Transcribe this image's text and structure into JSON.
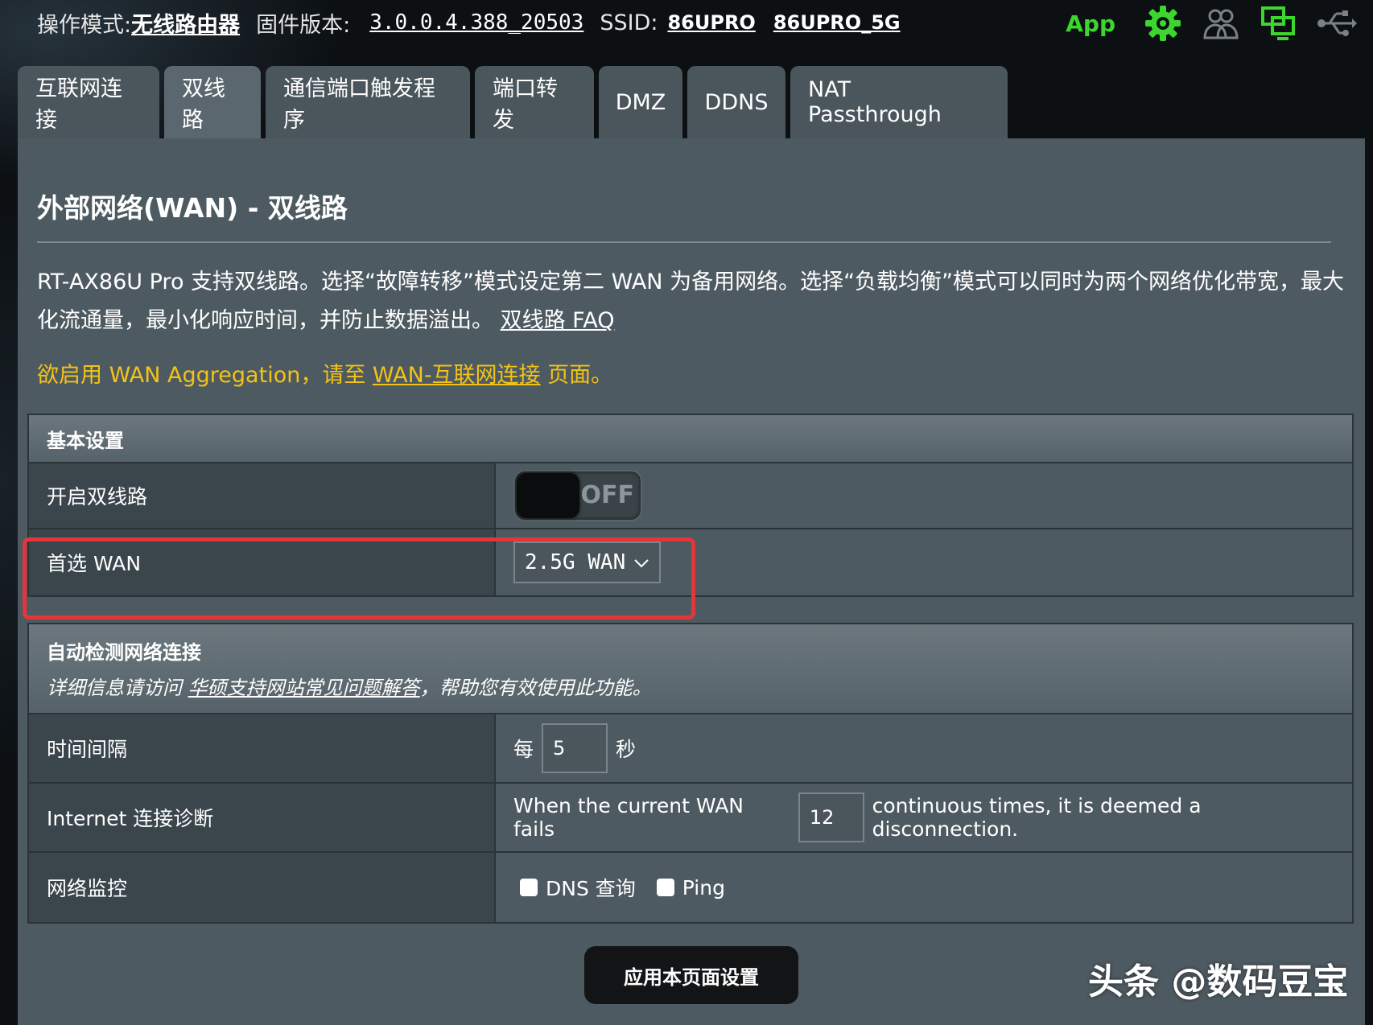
{
  "topbar": {
    "mode_label": "操作模式:",
    "mode_value": "无线路由器",
    "firmware_label": "固件版本:",
    "firmware_value": "3.0.0.4.388_20503",
    "ssid_label": "SSID:",
    "ssid_1": "86UPRO",
    "ssid_2": "86UPRO_5G",
    "app_label": "App",
    "icons": [
      "gear-icon",
      "users-icon",
      "network-icon",
      "usb-icon"
    ],
    "accent_color": "#3dd62e"
  },
  "tabs": [
    {
      "label": "互联网连接",
      "active": false
    },
    {
      "label": "双线路",
      "active": true
    },
    {
      "label": "通信端口触发程序",
      "active": false
    },
    {
      "label": "端口转发",
      "active": false
    },
    {
      "label": "DMZ",
      "active": false
    },
    {
      "label": "DDNS",
      "active": false
    },
    {
      "label": "NAT Passthrough",
      "active": false
    }
  ],
  "page": {
    "title": "外部网络(WAN) - 双线路",
    "description": "RT-AX86U Pro 支持双线路。选择“故障转移”模式设定第二 WAN 为备用网络。选择“负载均衡”模式可以同时为两个网络优化带宽，最大化流通量，最小化响应时间，并防止数据溢出。",
    "faq_link": "双线路 FAQ",
    "notice_prefix": "欲启用 WAN Aggregation，请至 ",
    "notice_link": "WAN-互联网连接",
    "notice_suffix": " 页面。",
    "notice_color": "#f3c317"
  },
  "basic": {
    "header": "基本设置",
    "dual_wan_label": "开启双线路",
    "dual_wan_toggle": "OFF",
    "primary_wan_label": "首选 WAN",
    "primary_wan_value": "2.5G WAN"
  },
  "detect": {
    "header": "自动检测网络连接",
    "subtitle_prefix": "详细信息请访问 ",
    "subtitle_link": "华硕支持网站常见问题解答",
    "subtitle_suffix": "，帮助您有效使用此功能。",
    "interval_label": "时间间隔",
    "interval_prefix": "每",
    "interval_value": "5",
    "interval_suffix": "秒",
    "diag_label": "Internet 连接诊断",
    "diag_prefix": "When the current WAN fails",
    "diag_value": "12",
    "diag_suffix": "continuous times, it is deemed a disconnection.",
    "monitor_label": "网络监控",
    "monitor_dns": "DNS 查询",
    "monitor_ping": "Ping"
  },
  "apply_button": "应用本页面设置",
  "watermark": "头条 @数码豆宝"
}
